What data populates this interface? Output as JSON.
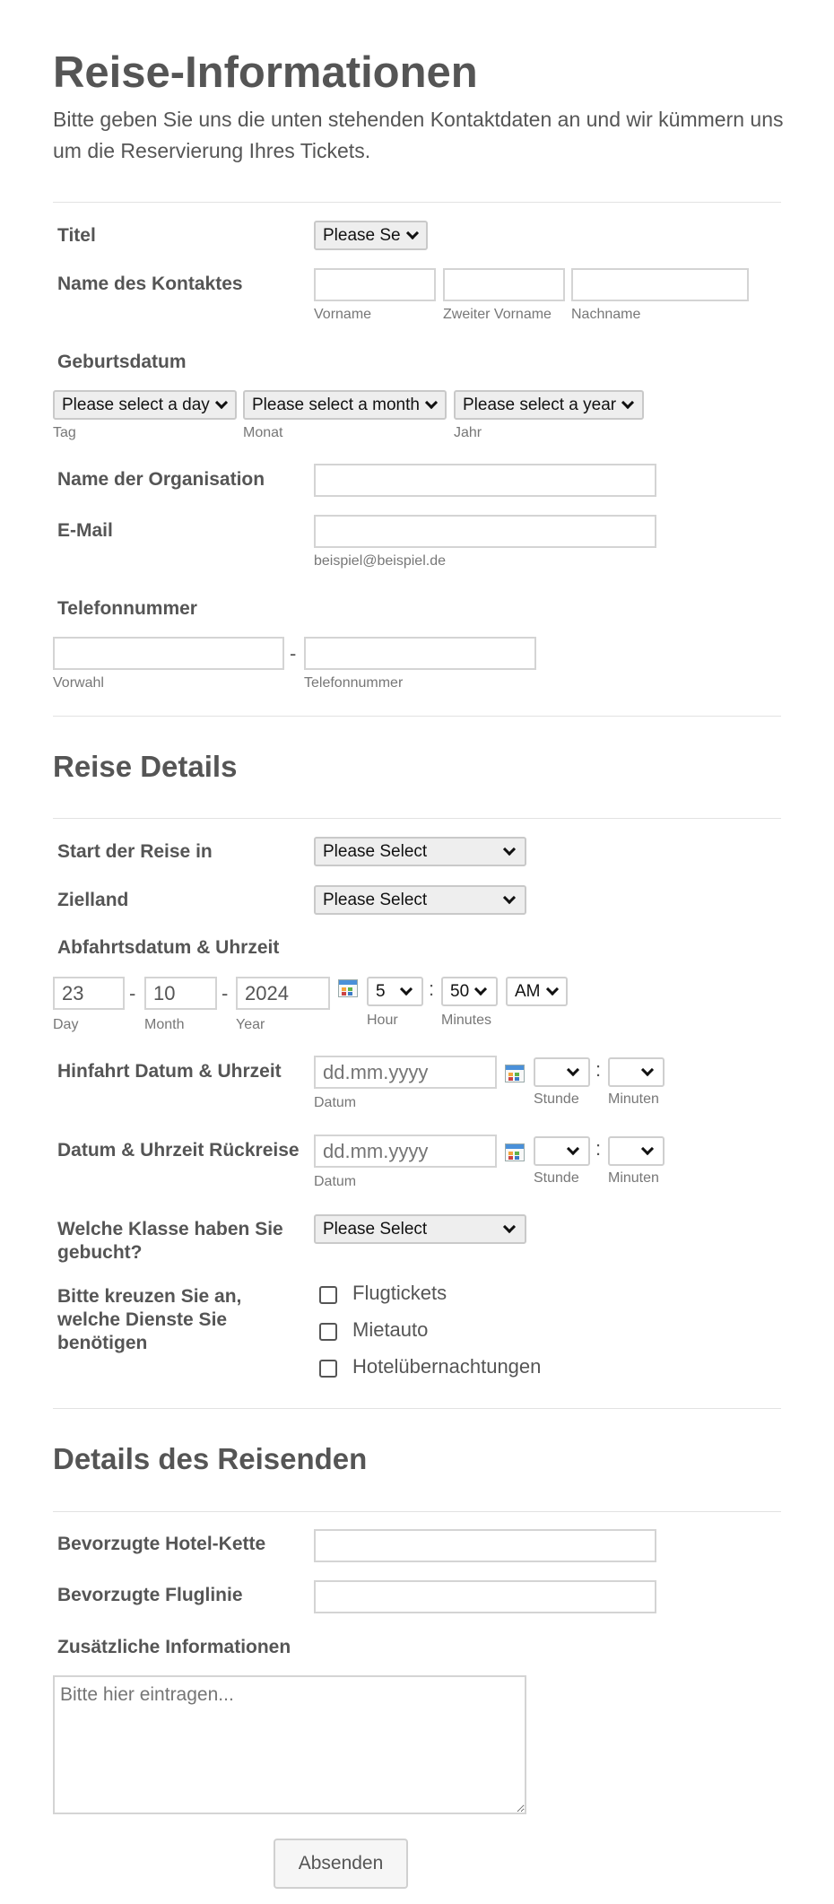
{
  "header": {
    "title": "Reise-Informationen",
    "description": "Bitte geben Sie uns die unten stehenden Kontaktdaten an und wir kümmern uns um die Reservierung Ihres Tickets."
  },
  "contact": {
    "titel_label": "Titel",
    "titel_value": "Please Se",
    "name_label": "Name des Kontaktes",
    "first_sub": "Vorname",
    "middle_sub": "Zweiter Vorname",
    "last_sub": "Nachname",
    "birth_label": "Geburtsdatum",
    "day_value": "Please select a day",
    "month_value": "Please select a month",
    "year_value": "Please select a year",
    "day_sub": "Tag",
    "month_sub": "Monat",
    "year_sub": "Jahr",
    "org_label": "Name der Organisation",
    "email_label": "E-Mail",
    "email_sub": "beispiel@beispiel.de",
    "phone_label": "Telefonnummer",
    "phone_dash": "-",
    "area_sub": "Vorwahl",
    "phone_sub": "Telefonnummer"
  },
  "travel": {
    "section_title": "Reise Details",
    "start_label": "Start der Reise in",
    "start_value": "Please Select",
    "dest_label": "Zielland",
    "dest_value": "Please Select",
    "depart_label": "Abfahrtsdatum & Uhrzeit",
    "depart_day": "23",
    "depart_month": "10",
    "depart_year": "2024",
    "depart_hour": "5",
    "depart_minute": "50",
    "depart_ampm": "AM",
    "dash": "-",
    "colon": ":",
    "day_sub": "Day",
    "month_sub": "Month",
    "year_sub": "Year",
    "hour_sub": "Hour",
    "minutes_sub": "Minutes",
    "outbound_label": "Hinfahrt Datum & Uhrzeit",
    "date_placeholder": "dd.mm.yyyy",
    "datum_sub": "Datum",
    "stunde_sub": "Stunde",
    "minuten_sub": "Minuten",
    "return_label": "Datum & Uhrzeit Rückreise",
    "class_label": "Welche Klasse haben Sie gebucht?",
    "class_value": "Please Select",
    "services_label": "Bitte kreuzen Sie an, welche Dienste Sie benötigen",
    "services": [
      "Flugtickets",
      "Mietauto",
      "Hotelübernachtungen"
    ]
  },
  "traveler": {
    "section_title": "Details des Reisenden",
    "hotel_label": "Bevorzugte Hotel-Kette",
    "airline_label": "Bevorzugte Fluglinie",
    "info_label": "Zusätzliche Informationen",
    "info_placeholder": "Bitte hier eintragen..."
  },
  "submit_label": "Absenden"
}
